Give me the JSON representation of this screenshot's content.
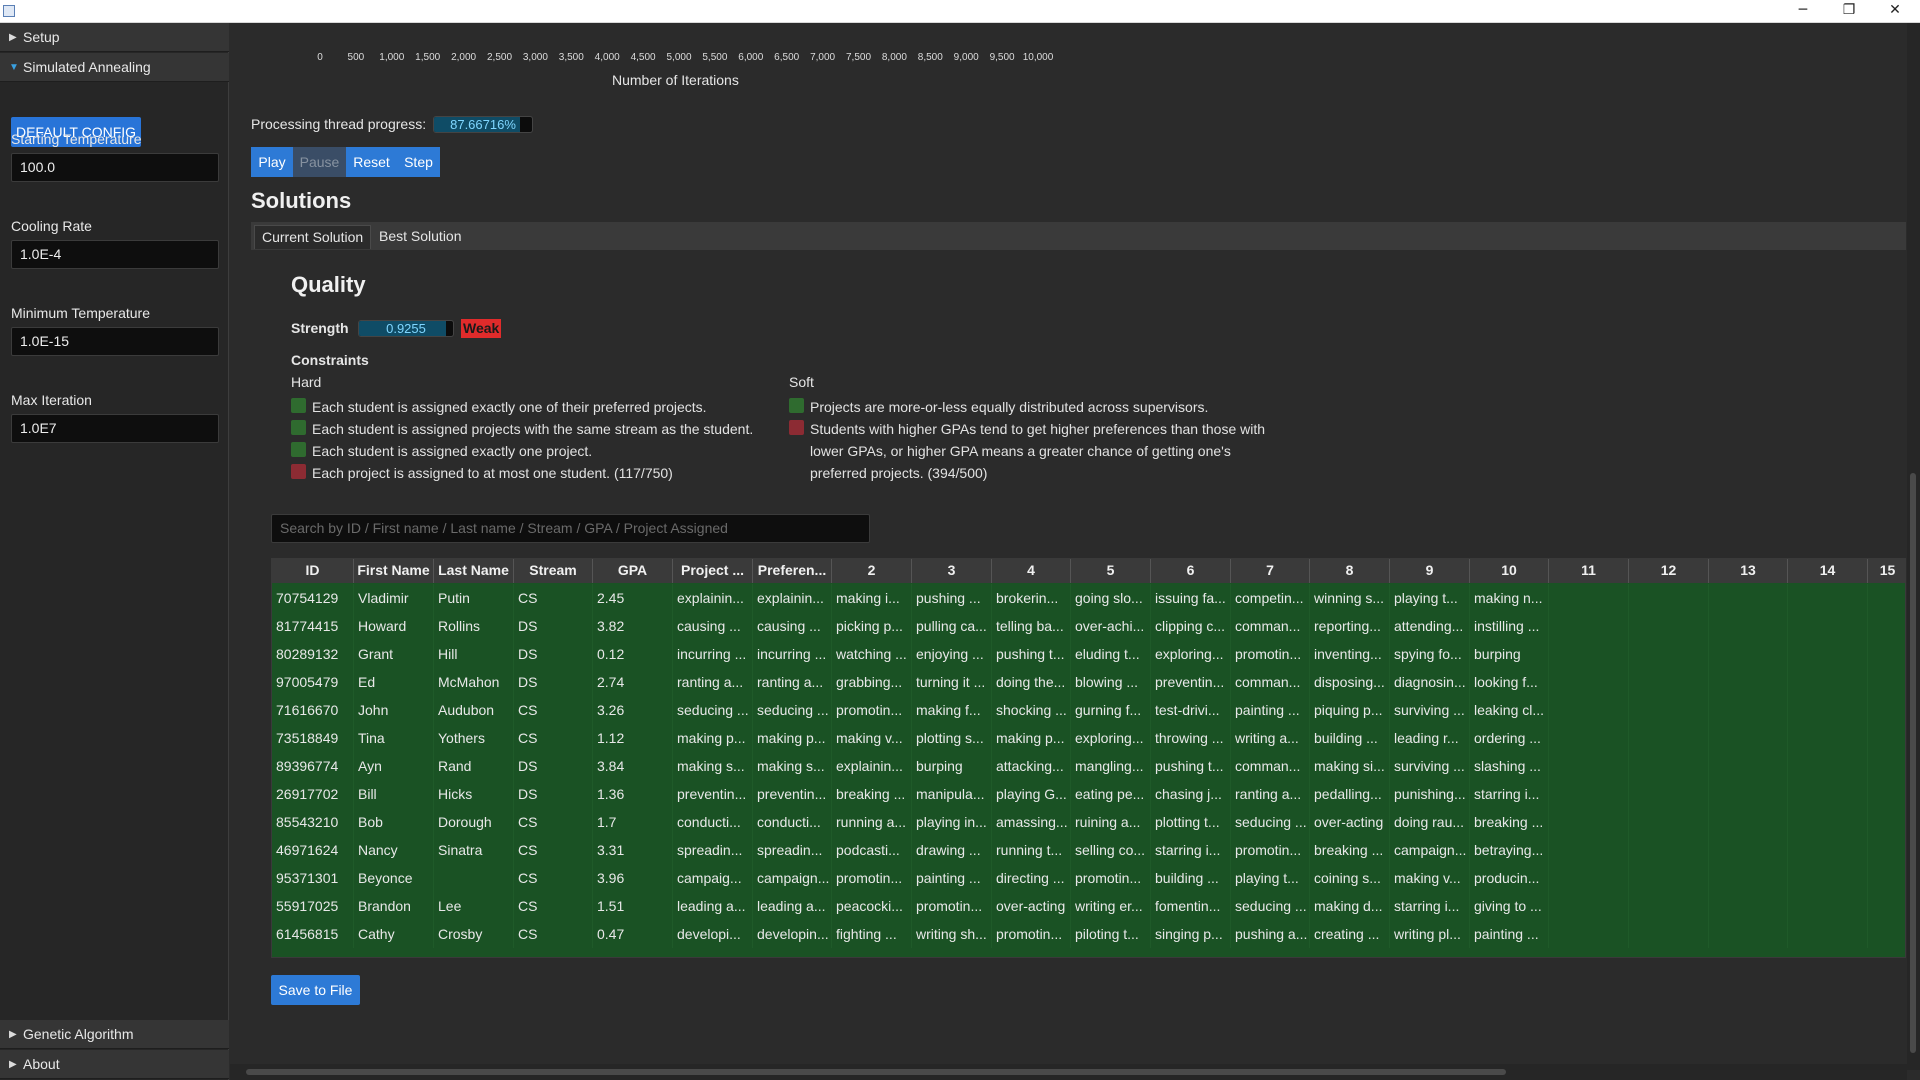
{
  "window": {
    "minimize": "─",
    "restore": "❐",
    "close": "✕"
  },
  "sidebar": {
    "setup": "Setup",
    "sa": "Simulated Annealing",
    "default_config": "DEFAULT CONFIG",
    "starting_temp_label": "Starting Temperature",
    "starting_temp": "100.0",
    "cooling_rate_label": "Cooling Rate",
    "cooling_rate": "1.0E-4",
    "min_temp_label": "Minimum Temperature",
    "min_temp": "1.0E-15",
    "max_iter_label": "Max Iteration",
    "max_iter": "1.0E7",
    "genetic": "Genetic Algorithm",
    "about": "About"
  },
  "chart": {
    "x_ticks": [
      "0",
      "500",
      "1,000",
      "1,500",
      "2,000",
      "2,500",
      "3,000",
      "3,500",
      "4,000",
      "4,500",
      "5,000",
      "5,500",
      "6,000",
      "6,500",
      "7,000",
      "7,500",
      "8,000",
      "8,500",
      "9,000",
      "9,500",
      "10,000"
    ],
    "xlabel": "Number of Iterations"
  },
  "progress": {
    "label": "Processing thread progress:",
    "value": 0.8766716,
    "text": "87.66716%"
  },
  "controls": {
    "play": "Play",
    "pause": "Pause",
    "reset": "Reset",
    "step": "Step"
  },
  "solutions": {
    "title": "Solutions",
    "tabs": [
      "Current Solution",
      "Best Solution"
    ],
    "quality_title": "Quality",
    "strength_label": "Strength",
    "strength_value": 0.9255,
    "strength_text": "0.9255",
    "strength_badge": "Weak",
    "colors": {
      "ok": "#2f6b2f",
      "bad": "#8c2b33",
      "badge": "#e02b2b"
    },
    "constraints_label": "Constraints",
    "hard_label": "Hard",
    "soft_label": "Soft",
    "hard": [
      {
        "text": "Each student is assigned exactly one of their preferred projects.",
        "ok": true
      },
      {
        "text": "Each student is assigned projects with the same stream as the student.",
        "ok": true
      },
      {
        "text": "Each student is assigned exactly one project.",
        "ok": true
      },
      {
        "text": "Each project is assigned to at most one student. (117/750)",
        "ok": false
      }
    ],
    "soft": [
      {
        "text": "Projects are more-or-less equally distributed across supervisors.",
        "ok": true
      },
      {
        "text": "Students with higher GPAs tend to get higher preferences than those with lower GPAs, or higher GPA means a greater chance of getting one's preferred projects. (394/500)",
        "ok": false
      }
    ]
  },
  "search": {
    "placeholder": "Search by ID / First name / Last name / Stream / GPA / Project Assigned"
  },
  "table": {
    "columns": [
      "ID",
      "First Name",
      "Last Name",
      "Stream",
      "GPA",
      "Project ...",
      "Preferen...",
      "2",
      "3",
      "4",
      "5",
      "6",
      "7",
      "8",
      "9",
      "10",
      "11",
      "12",
      "13",
      "14",
      "15"
    ],
    "rows": [
      [
        "70754129",
        "Vladimir",
        "Putin",
        "CS",
        "2.45",
        "explainin...",
        "explainin...",
        "making i...",
        "pushing ...",
        "brokerin...",
        "going slo...",
        "issuing fa...",
        "competin...",
        "winning s...",
        "playing t...",
        "making n..."
      ],
      [
        "81774415",
        "Howard",
        "Rollins",
        "DS",
        "3.82",
        "causing ...",
        "causing ...",
        "picking p...",
        "pulling ca...",
        "telling ba...",
        "over-achi...",
        "clipping c...",
        "comman...",
        "reporting...",
        "attending...",
        "instilling ..."
      ],
      [
        "80289132",
        "Grant",
        "Hill",
        "DS",
        "0.12",
        "incurring ...",
        "incurring ...",
        "watching ...",
        "enjoying ...",
        "pushing t...",
        "eluding t...",
        "exploring...",
        "promotin...",
        "inventing...",
        "spying fo...",
        "burping"
      ],
      [
        "97005479",
        "Ed",
        "McMahon",
        "DS",
        "2.74",
        "ranting a...",
        "ranting a...",
        "grabbing...",
        "turning it ...",
        "doing the...",
        "blowing ...",
        "preventin...",
        "comman...",
        "disposing...",
        "diagnosin...",
        "looking f..."
      ],
      [
        "71616670",
        "John",
        "Audubon",
        "CS",
        "3.26",
        "seducing ...",
        "seducing ...",
        "promotin...",
        "making f...",
        "shocking ...",
        "gurning f...",
        "test-drivi...",
        "painting ...",
        "piquing p...",
        "surviving ...",
        "leaking cl..."
      ],
      [
        "73518849",
        "Tina",
        "Yothers",
        "CS",
        "1.12",
        "making p...",
        "making p...",
        "making v...",
        "plotting s...",
        "making p...",
        "exploring...",
        "throwing ...",
        "writing a...",
        "building ...",
        "leading r...",
        "ordering ..."
      ],
      [
        "89396774",
        "Ayn",
        "Rand",
        "DS",
        "3.84",
        "making s...",
        "making s...",
        "explainin...",
        "burping",
        "attacking...",
        "mangling...",
        "pushing t...",
        "comman...",
        "making si...",
        "surviving ...",
        "slashing ..."
      ],
      [
        "26917702",
        "Bill",
        "Hicks",
        "DS",
        "1.36",
        "preventin...",
        "preventin...",
        "breaking ...",
        "manipula...",
        "playing G...",
        "eating pe...",
        "chasing j...",
        "ranting a...",
        "pedalling...",
        "punishing...",
        "starring i..."
      ],
      [
        "85543210",
        "Bob",
        "Dorough",
        "CS",
        "1.7",
        "conducti...",
        "conducti...",
        "running a...",
        "playing in...",
        "amassing...",
        "ruining a...",
        "plotting t...",
        "seducing ...",
        "over-acting",
        "doing rau...",
        "breaking ..."
      ],
      [
        "46971624",
        "Nancy",
        "Sinatra",
        "CS",
        "3.31",
        "spreadin...",
        "spreadin...",
        "podcasti...",
        "drawing ...",
        "running t...",
        "selling co...",
        "starring i...",
        "promotin...",
        "breaking ...",
        "campaign...",
        "betraying..."
      ],
      [
        "95371301",
        "Beyonce",
        "",
        "CS",
        "3.96",
        "campaig...",
        "campaign...",
        "promotin...",
        "painting ...",
        "directing ...",
        "promotin...",
        "building ...",
        "playing t...",
        "coining s...",
        "making v...",
        "producin..."
      ],
      [
        "55917025",
        "Brandon",
        "Lee",
        "CS",
        "1.51",
        "leading a...",
        "leading a...",
        "peacocki...",
        "promotin...",
        "over-acting",
        "writing er...",
        "fomentin...",
        "seducing ...",
        "making d...",
        "starring i...",
        "giving to ..."
      ],
      [
        "61456815",
        "Cathy",
        "Crosby",
        "CS",
        "0.47",
        "developi...",
        "developin...",
        "fighting ...",
        "writing sh...",
        "promotin...",
        "piloting t...",
        "singing p...",
        "pushing a...",
        "creating ...",
        "writing pl...",
        "painting ..."
      ]
    ]
  },
  "save": "Save to File"
}
